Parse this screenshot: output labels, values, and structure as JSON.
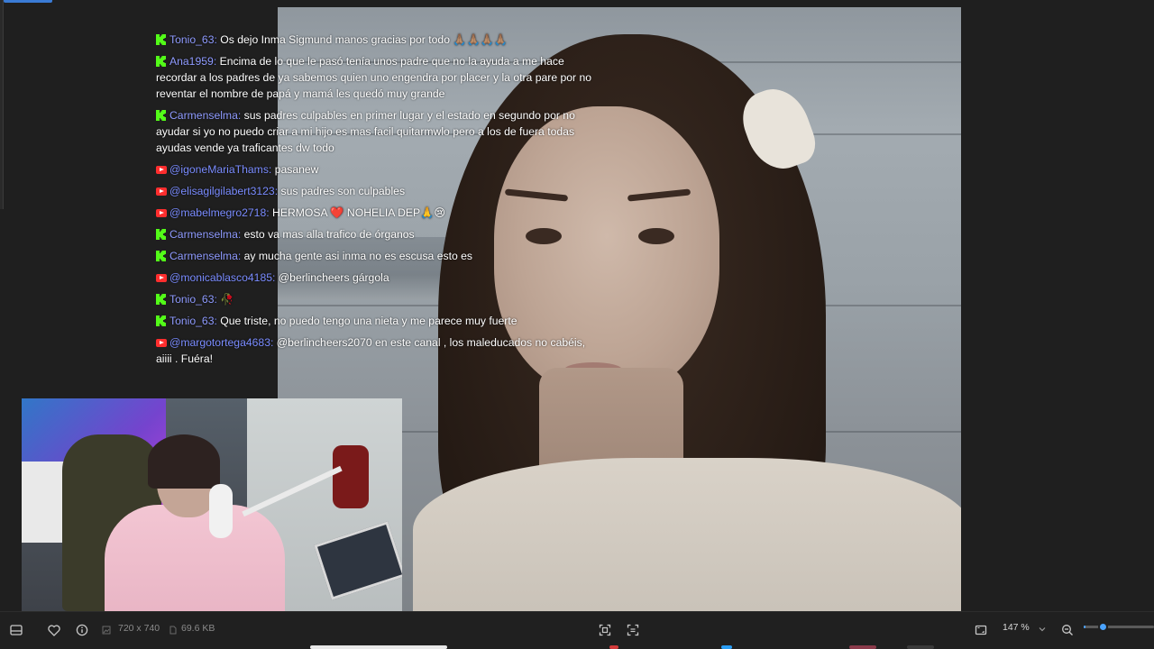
{
  "chat": {
    "messages": [
      {
        "platform": "kick",
        "user": "Tonio_63",
        "text": "Os dejo Inma Sigmund manos gracias por todo 🙏🏽🙏🏽🙏🏽🙏🏽"
      },
      {
        "platform": "kick",
        "user": "Ana1959",
        "text": "Encima de lo que le pasó tenía unos padre que no la ayuda a me hace recordar a los padres de ya sabemos quien uno engendra por placer y la otra pare por no reventar el nombre de papá y mamá les quedó muy grande"
      },
      {
        "platform": "kick",
        "user": "Carmenselma",
        "text": "sus padres culpables en primer lugar y el estado en segundo por no ayudar si yo no puedo criar a mi hijo es mas facil quitarmwlo pero a los de fuera todas ayudas vende ya traficantes dw todo"
      },
      {
        "platform": "youtube",
        "user": "@igoneMariaThams",
        "text": "pasanew"
      },
      {
        "platform": "youtube",
        "user": "@elisagilgilabert3123",
        "text": "sus padres son culpables"
      },
      {
        "platform": "youtube",
        "user": "@mabelmegro2718",
        "text": "HERMOSA ❤️ NOHELIA DEP🙏😢"
      },
      {
        "platform": "kick",
        "user": "Carmenselma",
        "text": "esto va mas alla trafico de órganos"
      },
      {
        "platform": "kick",
        "user": "Carmenselma",
        "text": "ay mucha gente asi inma no es escusa esto es"
      },
      {
        "platform": "youtube",
        "user": "@monicablasco4185",
        "text": "@berlincheers gárgola"
      },
      {
        "platform": "kick",
        "user": "Tonio_63",
        "text": "🥀"
      },
      {
        "platform": "kick",
        "user": "Tonio_63",
        "text": "Que triste, no puedo tengo una nieta y me parece muy fuerte"
      },
      {
        "platform": "youtube",
        "user": "@margotortega4683",
        "text": "@berlincheers2070 en este canal , los maleducados no cabéis, ajjjj . Fuéra!"
      }
    ]
  },
  "statusbar": {
    "dimensions": "720 x 740",
    "file_size": "69.6 KB",
    "zoom_label": "147 %",
    "zoom_level": 0.25
  },
  "colors": {
    "accent": "#4aa3ff",
    "kick_green": "#53fc18",
    "youtube_red": "#ff2e2e",
    "username": "#7a8cff"
  },
  "icons": {
    "statusbar_left": [
      "panel-icon",
      "heart-icon",
      "info-icon",
      "image-size-icon"
    ],
    "statusbar_right": [
      "fit-screen-icon",
      "actual-size-icon",
      "fullscreen-icon",
      "chevron-down-icon",
      "zoom-out-icon"
    ]
  }
}
